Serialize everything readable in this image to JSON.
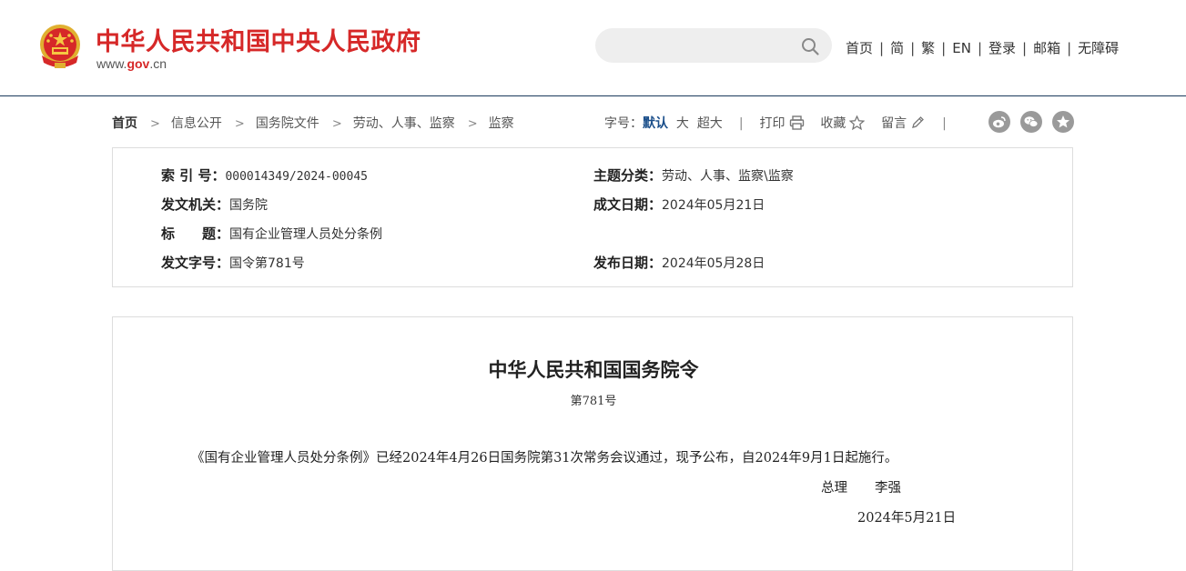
{
  "header": {
    "site_title": "中华人民共和国中央人民政府",
    "domain_prefix": "www.",
    "domain_gov": "gov",
    "domain_suffix": ".cn",
    "search_placeholder": "",
    "nav": [
      "首页",
      "简",
      "繁",
      "EN",
      "登录",
      "邮箱",
      "无障碍"
    ]
  },
  "breadcrumb": {
    "items": [
      "首页",
      "信息公开",
      "国务院文件",
      "劳动、人事、监察",
      "监察"
    ]
  },
  "tools": {
    "font_size_label": "字号：",
    "font_default": "默认",
    "font_large": "大",
    "font_xlarge": "超大",
    "print": "打印",
    "favorite": "收藏",
    "comment": "留言"
  },
  "info": {
    "index_label": "索 引 号：",
    "index_value": "000014349/2024-00045",
    "topic_label": "主题分类：",
    "topic_value": "劳动、人事、监察\\监察",
    "issuer_label": "发文机关：",
    "issuer_value": "国务院",
    "written_date_label": "成文日期：",
    "written_date_value": "2024年05月21日",
    "title_label": "标　　题：",
    "title_value": "国有企业管理人员处分条例",
    "doc_no_label": "发文字号：",
    "doc_no_value": "国令第781号",
    "publish_date_label": "发布日期：",
    "publish_date_value": "2024年05月28日"
  },
  "document": {
    "title": "中华人民共和国国务院令",
    "number": "第781号",
    "body": "《国有企业管理人员处分条例》已经2024年4月26日国务院第31次常务会议通过，现予公布，自2024年9月1日起施行。",
    "sign_role": "总理",
    "sign_name": "李强",
    "date": "2024年5月21日"
  },
  "colors": {
    "brand_red": "#d62828",
    "link_blue": "#1a4e8a",
    "header_border": "#1a3a5c"
  }
}
